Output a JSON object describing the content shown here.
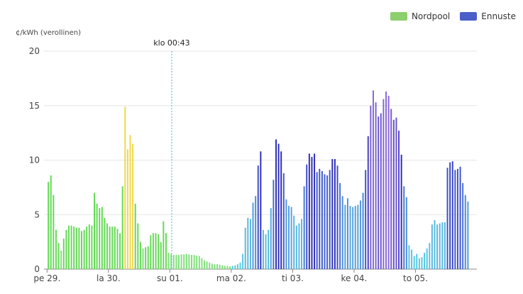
{
  "legend": {
    "nordpool_label": "Nordpool",
    "ennuste_label": "Ennuste",
    "nordpool_color": "#8ccf6e",
    "ennuste_color": "#4a5fc8"
  },
  "now_marker": {
    "label": "klo 00:43",
    "x_day": 2.03
  },
  "chart_data": {
    "type": "bar",
    "ylabel": "¢/kWh (verollinen)",
    "ylim": [
      0,
      20
    ],
    "y_ticks": [
      0,
      5,
      10,
      15,
      20
    ],
    "x_ticks": [
      {
        "label": "pe 29.",
        "day": 0
      },
      {
        "label": "la 30.",
        "day": 1
      },
      {
        "label": "su 01.",
        "day": 2
      },
      {
        "label": "ma 02.",
        "day": 3
      },
      {
        "label": "ti 03.",
        "day": 4
      },
      {
        "label": "ke 04.",
        "day": 5
      },
      {
        "label": "to 05.",
        "day": 6
      }
    ],
    "x_range_days": [
      -0.05,
      7.0
    ],
    "bar_width_hours": 0.55,
    "series": [
      {
        "name": "Nordpool",
        "start_hour": 0,
        "values": [
          8.0,
          8.6,
          6.8,
          3.6,
          2.4,
          1.7,
          2.8,
          3.6,
          4.0,
          4.0,
          3.9,
          3.8,
          3.8,
          3.5,
          3.6,
          3.9,
          4.1,
          4.0,
          7.0,
          6.0,
          5.6,
          5.7,
          4.7,
          4.2,
          3.9,
          3.9,
          3.9,
          3.7,
          3.3,
          7.6,
          14.9,
          11.0,
          12.3,
          11.5,
          6.0,
          4.2,
          2.5,
          1.9,
          2.0,
          2.1,
          3.1,
          3.3,
          3.3,
          3.2,
          2.5,
          4.4,
          3.3,
          1.5,
          1.4,
          1.3,
          1.3,
          1.3,
          1.35,
          1.35,
          1.4,
          1.35,
          1.3,
          1.3,
          1.25,
          1.2,
          1.0,
          0.8,
          0.7,
          0.6,
          0.5,
          0.45,
          0.45,
          0.4,
          0.35,
          0.3,
          0.3,
          0.25
        ]
      },
      {
        "name": "Ennuste",
        "start_hour": 72,
        "values": [
          0.3,
          0.35,
          0.45,
          0.6,
          1.4,
          3.8,
          4.7,
          4.6,
          6.1,
          6.7,
          9.5,
          10.8,
          3.6,
          3.2,
          3.6,
          5.6,
          8.2,
          11.9,
          11.5,
          10.8,
          8.8,
          6.4,
          5.8,
          5.7,
          4.9,
          4.0,
          4.2,
          4.6,
          7.6,
          9.6,
          10.6,
          10.3,
          10.6,
          8.9,
          9.2,
          9.0,
          8.7,
          8.6,
          9.1,
          10.1,
          10.1,
          9.5,
          7.9,
          6.7,
          5.9,
          6.5,
          5.8,
          5.7,
          5.8,
          5.9,
          6.3,
          7.0,
          9.1,
          12.2,
          15.0,
          16.4,
          15.3,
          14.0,
          14.3,
          15.6,
          16.3,
          15.9,
          14.7,
          13.7,
          13.9,
          12.7,
          10.5,
          7.6,
          6.6,
          2.2,
          1.8,
          1.2,
          1.4,
          1.0,
          1.1,
          1.5,
          1.9,
          2.4,
          4.1,
          4.5,
          4.1,
          4.2,
          4.3,
          4.3,
          9.3,
          9.8,
          9.9,
          9.1,
          9.2,
          9.4,
          7.9,
          6.8,
          6.2
        ]
      }
    ]
  }
}
